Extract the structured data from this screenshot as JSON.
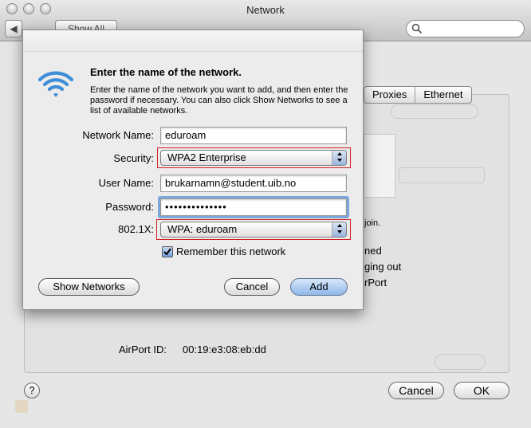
{
  "window": {
    "title": "Network",
    "show_all": "Show All",
    "search_placeholder": ""
  },
  "background": {
    "tabs": [
      "Proxies",
      "Ethernet"
    ],
    "fragments": {
      "join": "join.",
      "ned": "ned",
      "ging_out": "ging out",
      "rport": "rPort"
    },
    "airport_id_label": "AirPort ID:",
    "airport_id_value": "00:19:e3:08:eb:dd",
    "cancel": "Cancel",
    "ok": "OK",
    "help": "?"
  },
  "dialog": {
    "heading": "Enter the name of the network.",
    "description": "Enter the name of the network you want to add, and then enter the password if necessary. You can also click Show Networks to see a list of available networks.",
    "network_name_label": "Network Name:",
    "network_name_value": "eduroam",
    "security_label": "Security:",
    "security_value": "WPA2 Enterprise",
    "user_name_label": "User Name:",
    "user_name_value": "brukarnamn@student.uib.no",
    "password_label": "Password:",
    "password_value": "••••••••••••••",
    "config_label": "802.1X:",
    "config_value": "WPA: eduroam",
    "remember_label": "Remember this network",
    "remember_checked": true,
    "show_networks": "Show Networks",
    "cancel": "Cancel",
    "add": "Add"
  },
  "colors": {
    "highlight_box": "#d21f1f",
    "focus_ring": "#7ba7d9",
    "wifi_blue": "#3f8ed8"
  }
}
